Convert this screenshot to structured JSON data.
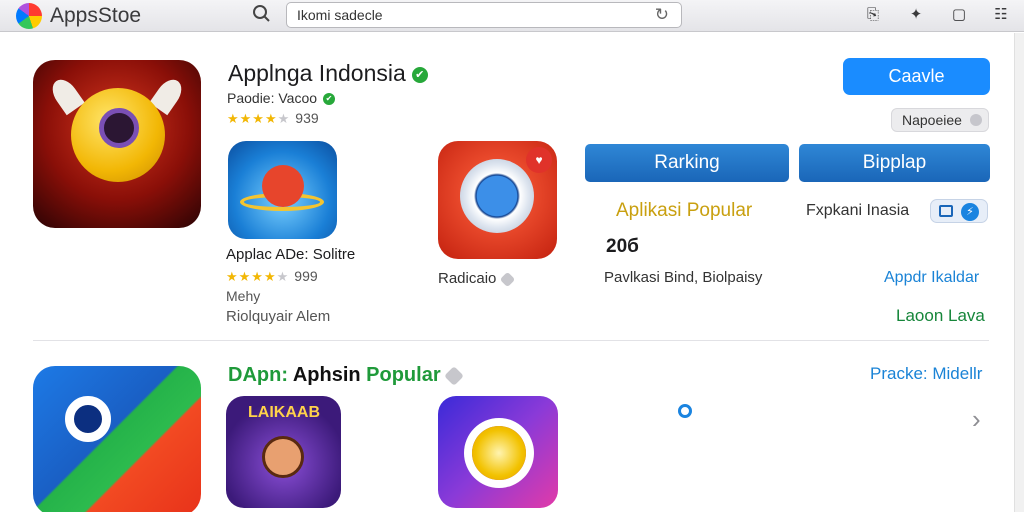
{
  "window": {
    "app_name": "AppsStoe",
    "search_value": "Ikomi sadecle"
  },
  "colors": {
    "accent": "#1a8cff",
    "button_blue": "#1a66b8",
    "green": "#1f9a3a",
    "star": "#f2b705"
  },
  "featured": {
    "title": "Applnga Indonsia",
    "publisher": "Paodie: Vacoo",
    "rating_value": "939",
    "rating_stars": 4,
    "primary_button": "Caavle",
    "secondary_pill": "Napoeiee"
  },
  "tiles": [
    {
      "name": "Applac ADe: Solitre",
      "rating_value": "999",
      "rating_stars": 4,
      "meta1": "Mehy",
      "meta2": "Riolquyair Alem"
    },
    {
      "name": "Radicaio"
    }
  ],
  "tabs": {
    "left": "Rarking",
    "right": "Bipplap"
  },
  "popular_block": {
    "heading": "Aplikasi Popular",
    "count": "20б",
    "subtitle": "Pavlkasi Bind, Biolpaisy",
    "label_right": "Fxpkani Inasia",
    "link1": "Appdr Ikaldar",
    "link2": "Laoon Lava"
  },
  "section2": {
    "heading_prefix": "DApn:",
    "heading_mid": "Aphsin",
    "heading_suffix": "Popular",
    "link": "Pracke: Midellr",
    "tile_d_label": "LAIKAAB"
  },
  "icons": {
    "search": "search-icon",
    "reload": "reload-icon",
    "bookmark": "bookmark-icon",
    "sparkle": "sparkle-icon",
    "window": "window-icon",
    "grid": "grid-icon",
    "chevron": "chevron-right-icon"
  }
}
